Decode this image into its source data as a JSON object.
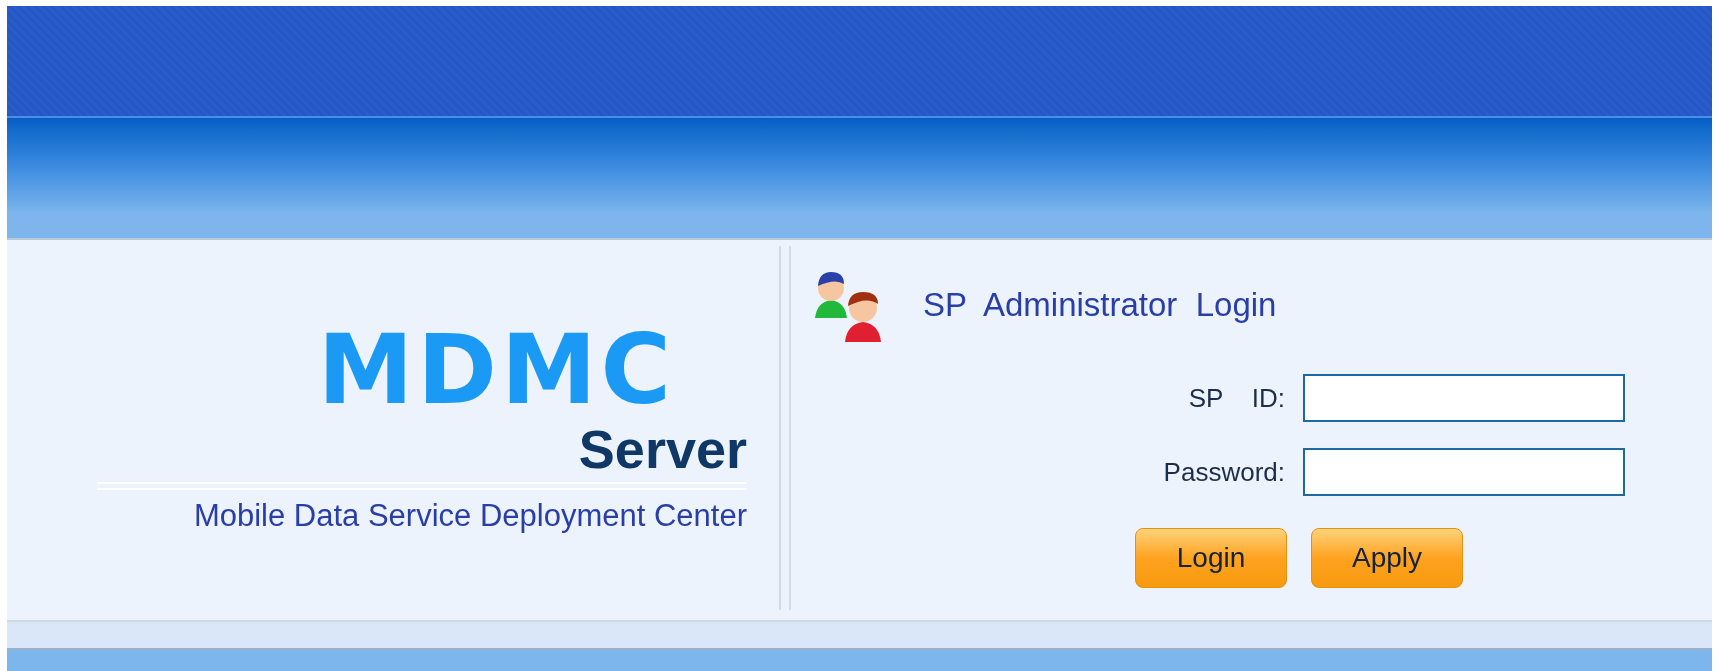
{
  "logo": {
    "mark": "MDMC",
    "product": "Server",
    "subtitle": "Mobile Data Service Deployment Center"
  },
  "login": {
    "title": "SP  Administrator  Login",
    "fields": [
      {
        "label": "SP    ID:"
      },
      {
        "label": "Password:"
      }
    ],
    "buttons": [
      "Login",
      "Apply"
    ]
  }
}
